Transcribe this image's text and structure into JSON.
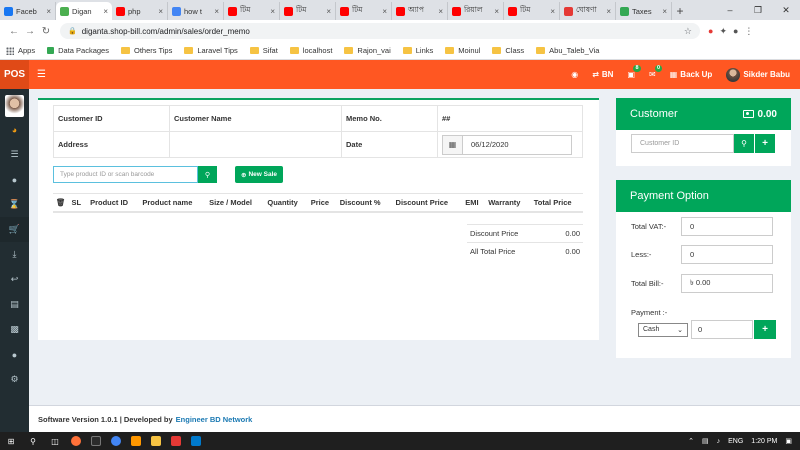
{
  "browser": {
    "tabs": [
      {
        "title": "Faceb",
        "color": "#1877f2"
      },
      {
        "title": "Digan",
        "color": "#4caf50",
        "active": true
      },
      {
        "title": "php",
        "color": "#ff0000"
      },
      {
        "title": "how t",
        "color": "#4285f4"
      },
      {
        "title": "টিম",
        "color": "#ff0000"
      },
      {
        "title": "টিম",
        "color": "#ff0000"
      },
      {
        "title": "টিম",
        "color": "#ff0000"
      },
      {
        "title": "অ্যাপ",
        "color": "#ff0000"
      },
      {
        "title": "রিয়াল",
        "color": "#ff0000"
      },
      {
        "title": "টিম",
        "color": "#ff0000"
      },
      {
        "title": "ঘোষণা",
        "color": "#e53935"
      },
      {
        "title": "Taxes",
        "color": "#34a853"
      }
    ],
    "url": "diganta.shop-bill.com/admin/sales/order_memo",
    "bookmarks": [
      "Apps",
      "Data Packages",
      "Others Tips",
      "Laravel Tips",
      "Sifat",
      "localhost",
      "Rajon_vai",
      "Links",
      "Moinul",
      "Class",
      "Abu_Taleb_Via"
    ]
  },
  "header": {
    "logo": "POS",
    "language": "BN",
    "messages_count": "8",
    "notifications_count": "0",
    "backup_label": "Back Up",
    "user_name": "Sikder Babu"
  },
  "memo": {
    "customer_id_label": "Customer ID",
    "customer_name_label": "Customer Name",
    "memo_no_label": "Memo No.",
    "memo_no_value": "##",
    "address_label": "Address",
    "date_label": "Date",
    "date_value": "06/12/2020",
    "product_placeholder": "Type product ID or scan barcode",
    "new_sale_label": "New Sale",
    "columns": [
      "SL",
      "Product ID",
      "Product name",
      "Size / Model",
      "Quantity",
      "Price",
      "Discount %",
      "Discount Price",
      "EMI",
      "Warranty",
      "Total Price"
    ],
    "totals": {
      "discount_price_label": "Discount Price",
      "discount_price_value": "0.00",
      "all_total_label": "All Total Price",
      "all_total_value": "0.00"
    }
  },
  "customer_panel": {
    "title": "Customer",
    "amount": "0.00",
    "id_placeholder": "Customer ID"
  },
  "payment_panel": {
    "title": "Payment Option",
    "vat_label": "Total VAT:-",
    "vat_value": "0",
    "less_label": "Less:-",
    "less_value": "0",
    "bill_label": "Total Bill:-",
    "bill_value": "৳ 0.00",
    "payment_label": "Payment :-",
    "method": "Cash",
    "amount_value": "0"
  },
  "footer": {
    "text": "Software Version 1.0.1 | Developed by",
    "link": "Engineer BD Network"
  },
  "taskbar": {
    "time": "1:20 PM",
    "lang": "ENG"
  }
}
